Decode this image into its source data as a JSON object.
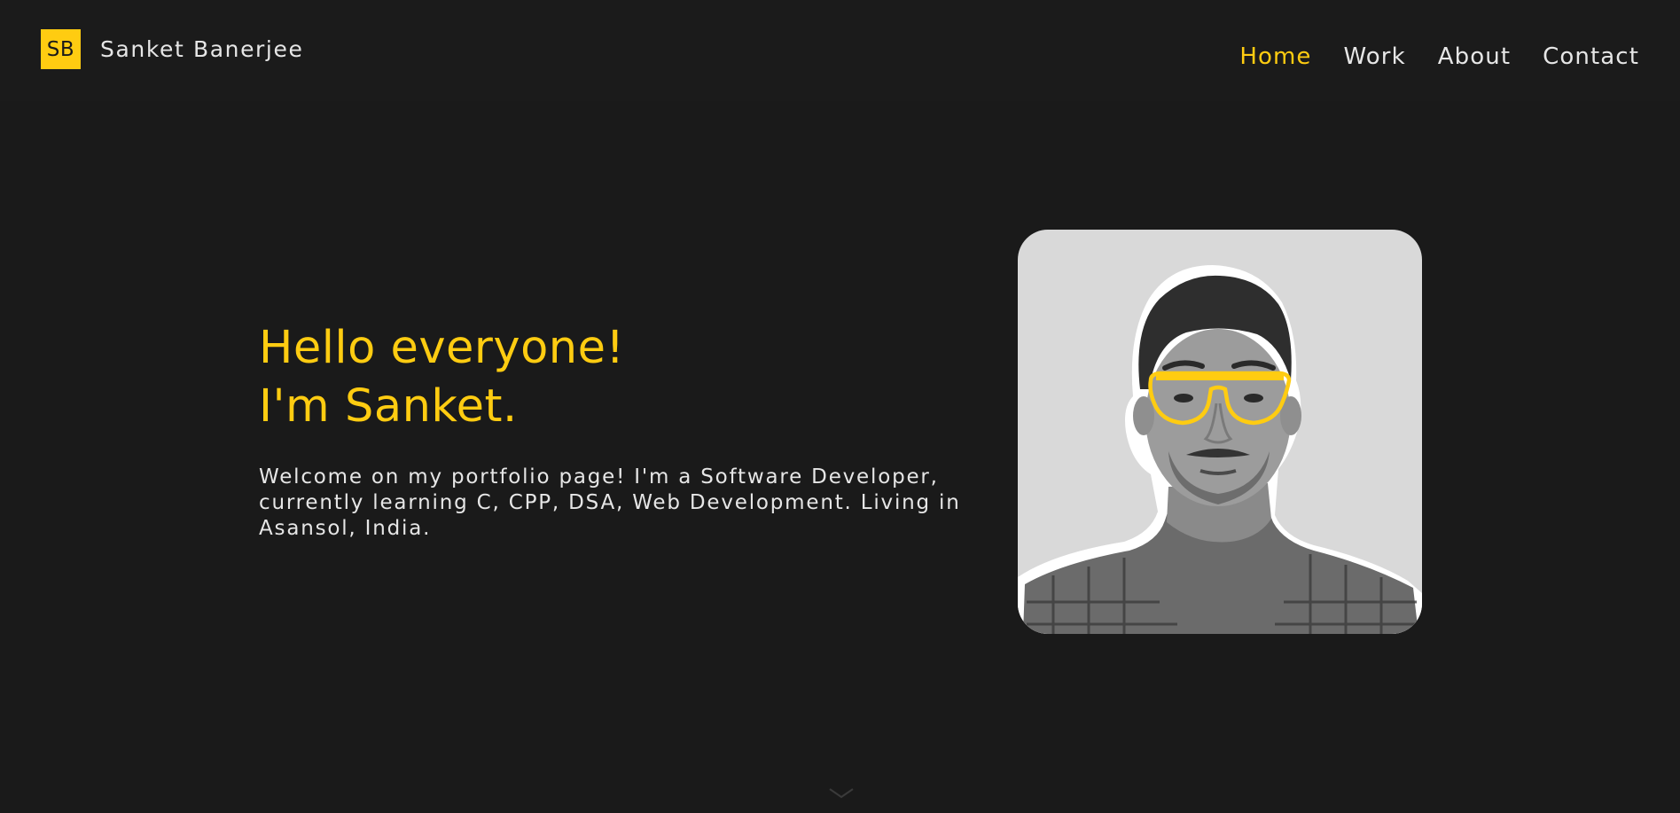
{
  "header": {
    "logo_initials": "SB",
    "logo_name": "Sanket Banerjee",
    "nav": [
      {
        "label": "Home",
        "active": true
      },
      {
        "label": "Work",
        "active": false
      },
      {
        "label": "About",
        "active": false
      },
      {
        "label": "Contact",
        "active": false
      }
    ]
  },
  "hero": {
    "title_line1": "Hello everyone!",
    "title_line2": "I'm Sanket.",
    "description": "Welcome on my portfolio page! I'm a Software Developer, currently learning C, CPP, DSA, Web Development. Living in Asansol, India."
  },
  "icons": {
    "scroll_down": "chevron-down-icon"
  },
  "colors": {
    "background": "#1a1a1a",
    "accent": "#ffcc11",
    "text": "#e6e6e6",
    "portrait_bg": "#d9d9d9"
  }
}
